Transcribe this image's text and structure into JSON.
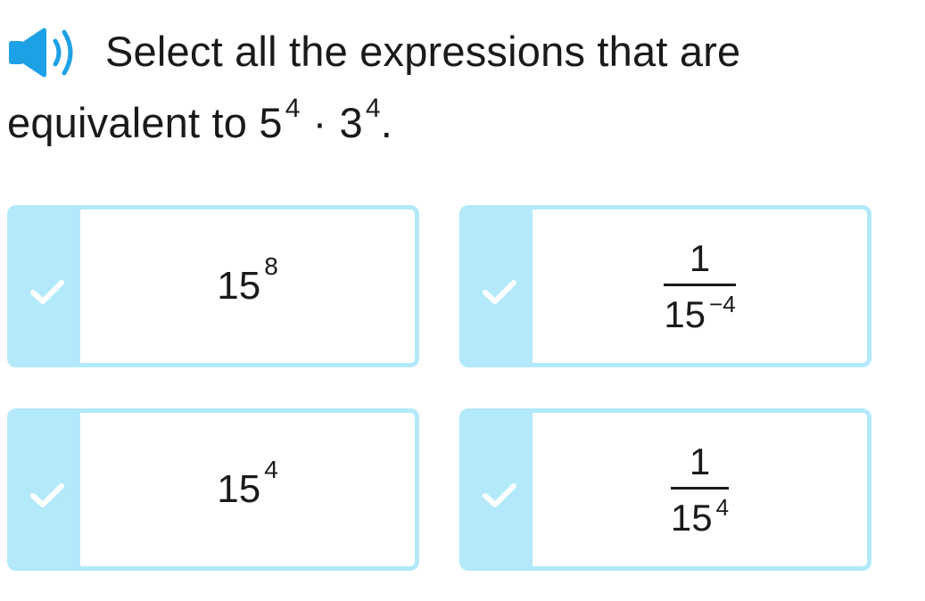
{
  "question": {
    "line1": "Select all the expressions that are",
    "line2_prefix": "equivalent to",
    "base1": "5",
    "exp1": "4",
    "operator": "·",
    "base2": "3",
    "exp2": "4",
    "period": "."
  },
  "options": [
    {
      "id": "a",
      "type": "power",
      "base": "15",
      "exp": "8"
    },
    {
      "id": "b",
      "type": "fraction",
      "numerator": "1",
      "den_base": "15",
      "den_exp": "−4"
    },
    {
      "id": "c",
      "type": "power",
      "base": "15",
      "exp": "4"
    },
    {
      "id": "d",
      "type": "fraction",
      "numerator": "1",
      "den_base": "15",
      "den_exp": "4"
    }
  ],
  "colors": {
    "accent": "#b3e9fb",
    "speaker": "#1da1e6",
    "text": "#1a1a1a"
  },
  "icons": {
    "speaker": "speaker-icon",
    "check": "check-icon"
  }
}
